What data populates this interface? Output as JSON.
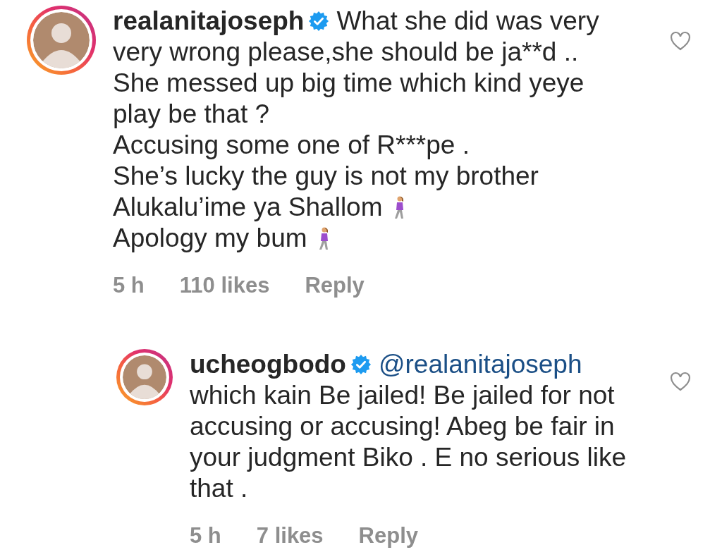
{
  "comments": [
    {
      "username": "realanitajoseph",
      "verified": true,
      "liked": false,
      "lines": [
        {
          "kind": "plain",
          "text": "What she did was very"
        },
        {
          "kind": "plain",
          "text": "very wrong please,she should be ja**d .."
        },
        {
          "kind": "plain",
          "text": "She messed up big time which kind yeye"
        },
        {
          "kind": "plain",
          "text": "play be that ?"
        },
        {
          "kind": "plain",
          "text": "Accusing some one of R***pe ."
        },
        {
          "kind": "plain",
          "text": "She’s lucky the guy is not my brother"
        },
        {
          "kind": "emoji",
          "text": "Alukalu’ime ya Shallom"
        },
        {
          "kind": "emoji",
          "text": "Apology my bum"
        }
      ],
      "time": "5 h",
      "likes": "110 likes",
      "reply_label": "Reply",
      "replies": [
        {
          "username": "ucheogbodo",
          "verified": true,
          "liked": false,
          "mention": "@realanitajoseph",
          "lines": [
            {
              "kind": "plain",
              "text": "which kain Be jailed! Be jailed for not"
            },
            {
              "kind": "plain",
              "text": "accusing or accusing! Abeg be fair in"
            },
            {
              "kind": "plain",
              "text": "your judgment Biko . E no serious like"
            },
            {
              "kind": "plain",
              "text": "that ."
            }
          ],
          "time": "5 h",
          "likes": "7 likes",
          "reply_label": "Reply"
        }
      ]
    }
  ]
}
